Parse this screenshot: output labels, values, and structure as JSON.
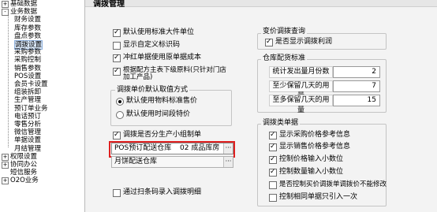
{
  "tree": {
    "items": [
      {
        "label": "基础数据",
        "toggle": "+"
      },
      {
        "label": "业务数据",
        "toggle": "-"
      },
      {
        "label": "财务设置"
      },
      {
        "label": "库存参数"
      },
      {
        "label": "盘点参数"
      },
      {
        "label": "调拨设置",
        "selected": true
      },
      {
        "label": "采购参数"
      },
      {
        "label": "采购控制"
      },
      {
        "label": "销售参数"
      },
      {
        "label": "POS设置"
      },
      {
        "label": "会员卡设置"
      },
      {
        "label": "组装拆卸"
      },
      {
        "label": "生产管理"
      },
      {
        "label": "预订单业务"
      },
      {
        "label": "电话预订"
      },
      {
        "label": "零售分析"
      },
      {
        "label": "微信管理"
      },
      {
        "label": "单据设置"
      },
      {
        "label": "月结管理"
      },
      {
        "label": "权限设置",
        "toggle": "+"
      },
      {
        "label": "协同办公",
        "toggle": "+"
      },
      {
        "label": "短信服务"
      },
      {
        "label": "O2O业务",
        "toggle": "+"
      }
    ]
  },
  "header": {
    "title": "调拨管理"
  },
  "left": {
    "checks": [
      {
        "label": "默认使用标准大件单位",
        "checked": true
      },
      {
        "label": "显示自定义标识码",
        "checked": false
      },
      {
        "label": "冲红单据使用原单据成本",
        "checked": true
      },
      {
        "label": "根据配方主表下级原料(只针对门店加工产品)",
        "checked": true
      }
    ],
    "price_group": {
      "title": "调拨单价默认取值方式",
      "options": [
        {
          "label": "默认使用物料标准售价",
          "selected": true
        },
        {
          "label": "默认使用时间段特价",
          "selected": false
        }
      ]
    },
    "produce_check": {
      "label": "调拨是否分生产小组制单",
      "checked": true
    },
    "pos_field": {
      "label": "POS预订配送仓库",
      "value": "02 成品库房"
    },
    "monthly_field": {
      "label": "月饼配送仓库",
      "value": ""
    },
    "scan_check": {
      "label": "通过扫条码录入调拨明细",
      "checked": false
    }
  },
  "right": {
    "transfer_query": {
      "title": "变价调拨查询",
      "check": {
        "label": "是否显示调拨利润",
        "checked": true
      }
    },
    "warehouse_std": {
      "title": "仓库配货标准",
      "rows": [
        {
          "label": "统计发出量月份数",
          "value": "2"
        },
        {
          "label": "至少保留几天的用量",
          "value": "7"
        },
        {
          "label": "至多保留几天的用量",
          "value": "15"
        }
      ]
    },
    "transfer_doc": {
      "title": "调拨类单据",
      "checks": [
        {
          "label": "显示采购价格参考信息",
          "checked": true
        },
        {
          "label": "显示销售价格参考信息",
          "checked": true
        },
        {
          "label": "控制价格输入小数位",
          "checked": true
        },
        {
          "label": "控制数量输入小数位",
          "checked": true
        },
        {
          "label": "是否控制买价调拨单调拨价不能修改",
          "checked": false
        },
        {
          "label": "控制相同单据只引入一次",
          "checked": false
        }
      ]
    }
  },
  "colors": {
    "selection": "#d8e6f7",
    "highlight_border": "#e02020"
  }
}
